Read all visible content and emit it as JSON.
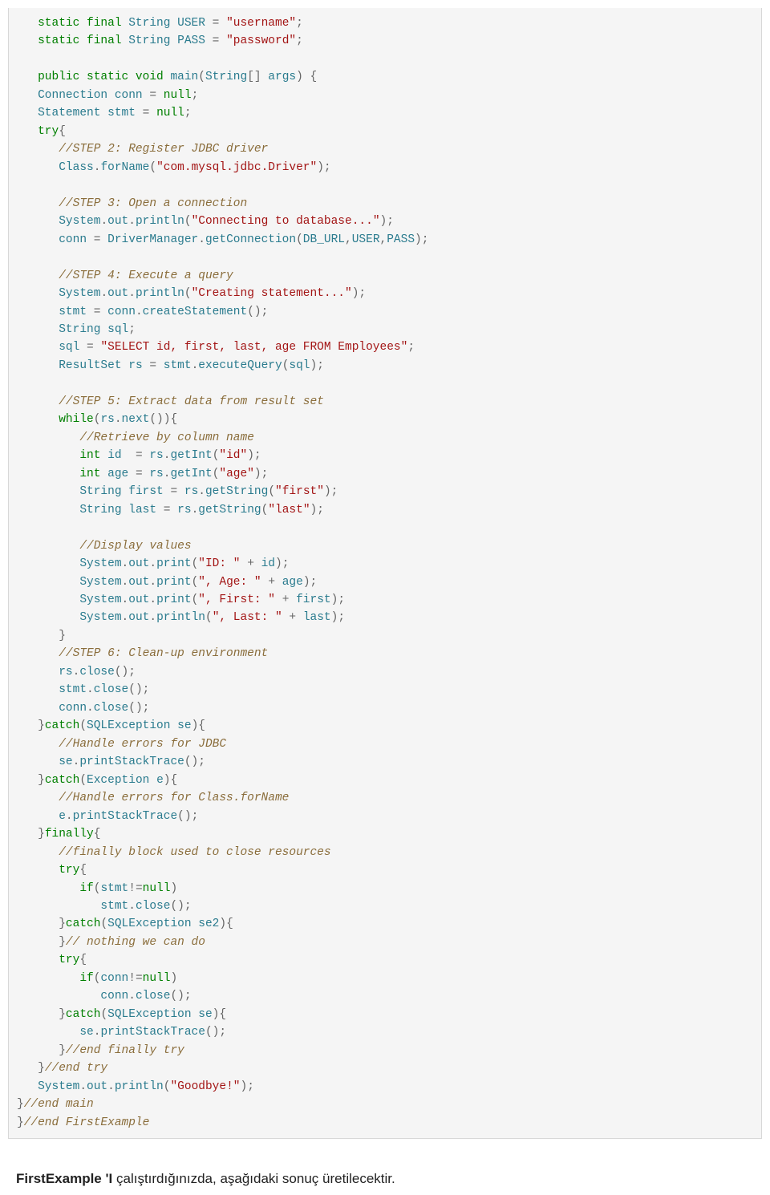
{
  "prose": {
    "sentence_a": "FirstExample 'I",
    "sentence_b": " çalıştırdığınızda, aşağıdaki sonuç üretilecektir."
  },
  "code": {
    "l01": {
      "indent": "   ",
      "k1": "static final",
      "t1": "String",
      "v1": "USER",
      "op1": "=",
      "s1": "\"username\"",
      "op2": ";"
    },
    "l02": {
      "indent": "   ",
      "k1": "static final",
      "t1": "String",
      "v1": "PASS",
      "op1": "=",
      "s1": "\"password\"",
      "op2": ";"
    },
    "l03": {
      "blank": true
    },
    "l04": {
      "indent": "   ",
      "k1": "public static void",
      "m1": "main",
      "op1": "(",
      "t1": "String",
      "op2": "[]",
      "v1": "args",
      "op3": ")",
      "op4": "{"
    },
    "l05": {
      "indent": "   ",
      "t1": "Connection",
      "v1": "conn",
      "op1": "=",
      "k1": "null",
      "op2": ";"
    },
    "l06": {
      "indent": "   ",
      "t1": "Statement",
      "v1": "stmt",
      "op1": "=",
      "k1": "null",
      "op2": ";"
    },
    "l07": {
      "indent": "   ",
      "k1": "try",
      "op1": "{"
    },
    "l08": {
      "indent": "      ",
      "c1": "//STEP 2: Register JDBC driver"
    },
    "l09": {
      "indent": "      ",
      "t1": "Class",
      "op1": ".",
      "m1": "forName",
      "op2": "(",
      "s1": "\"com.mysql.jdbc.Driver\"",
      "op3": ")",
      "op4": ";"
    },
    "l10": {
      "blank": true
    },
    "l11": {
      "indent": "      ",
      "c1": "//STEP 3: Open a connection"
    },
    "l12": {
      "indent": "      ",
      "t1": "System",
      "op1": ".",
      "v1": "out",
      "op2": ".",
      "m1": "println",
      "op3": "(",
      "s1": "\"Connecting to database...\"",
      "op4": ")",
      "op5": ";"
    },
    "l13": {
      "indent": "      ",
      "v1": "conn",
      "op1": "=",
      "t1": "DriverManager",
      "op2": ".",
      "m1": "getConnection",
      "op3": "(",
      "v2": "DB_URL",
      "op4": ",",
      "v3": "USER",
      "op5": ",",
      "v4": "PASS",
      "op6": ")",
      "op7": ";"
    },
    "l14": {
      "blank": true
    },
    "l15": {
      "indent": "      ",
      "c1": "//STEP 4: Execute a query"
    },
    "l16": {
      "indent": "      ",
      "t1": "System",
      "op1": ".",
      "v1": "out",
      "op2": ".",
      "m1": "println",
      "op3": "(",
      "s1": "\"Creating statement...\"",
      "op4": ")",
      "op5": ";"
    },
    "l17": {
      "indent": "      ",
      "v1": "stmt",
      "op1": "=",
      "v2": "conn",
      "op2": ".",
      "m1": "createStatement",
      "op3": "()",
      "op4": ";"
    },
    "l18": {
      "indent": "      ",
      "t1": "String",
      "v1": "sql",
      "op1": ";"
    },
    "l19": {
      "indent": "      ",
      "v1": "sql",
      "op1": "=",
      "s1": "\"SELECT id, first, last, age FROM Employees\"",
      "op2": ";"
    },
    "l20": {
      "indent": "      ",
      "t1": "ResultSet",
      "v1": "rs",
      "op1": "=",
      "v2": "stmt",
      "op2": ".",
      "m1": "executeQuery",
      "op3": "(",
      "v3": "sql",
      "op4": ")",
      "op5": ";"
    },
    "l21": {
      "blank": true
    },
    "l22": {
      "indent": "      ",
      "c1": "//STEP 5: Extract data from result set"
    },
    "l23": {
      "indent": "      ",
      "k1": "while",
      "op1": "(",
      "v1": "rs",
      "op2": ".",
      "m1": "next",
      "op3": "())",
      "op4": "{"
    },
    "l24": {
      "indent": "         ",
      "c1": "//Retrieve by column name"
    },
    "l25": {
      "indent": "         ",
      "k1": "int",
      "v1": "id",
      "sp": "  ",
      "op1": "=",
      "v2": "rs",
      "op2": ".",
      "m1": "getInt",
      "op3": "(",
      "s1": "\"id\"",
      "op4": ")",
      "op5": ";"
    },
    "l26": {
      "indent": "         ",
      "k1": "int",
      "v1": "age",
      "op1": "=",
      "v2": "rs",
      "op2": ".",
      "m1": "getInt",
      "op3": "(",
      "s1": "\"age\"",
      "op4": ")",
      "op5": ";"
    },
    "l27": {
      "indent": "         ",
      "t1": "String",
      "v1": "first",
      "op1": "=",
      "v2": "rs",
      "op2": ".",
      "m1": "getString",
      "op3": "(",
      "s1": "\"first\"",
      "op4": ")",
      "op5": ";"
    },
    "l28": {
      "indent": "         ",
      "t1": "String",
      "v1": "last",
      "op1": "=",
      "v2": "rs",
      "op2": ".",
      "m1": "getString",
      "op3": "(",
      "s1": "\"last\"",
      "op4": ")",
      "op5": ";"
    },
    "l29": {
      "blank": true
    },
    "l30": {
      "indent": "         ",
      "c1": "//Display values"
    },
    "l31": {
      "indent": "         ",
      "t1": "System",
      "op1": ".",
      "v1": "out",
      "op2": ".",
      "m1": "print",
      "op3": "(",
      "s1": "\"ID: \"",
      "op4": "+",
      "v2": "id",
      "op5": ")",
      "op6": ";"
    },
    "l32": {
      "indent": "         ",
      "t1": "System",
      "op1": ".",
      "v1": "out",
      "op2": ".",
      "m1": "print",
      "op3": "(",
      "s1": "\", Age: \"",
      "op4": "+",
      "v2": "age",
      "op5": ")",
      "op6": ";"
    },
    "l33": {
      "indent": "         ",
      "t1": "System",
      "op1": ".",
      "v1": "out",
      "op2": ".",
      "m1": "print",
      "op3": "(",
      "s1": "\", First: \"",
      "op4": "+",
      "v2": "first",
      "op5": ")",
      "op6": ";"
    },
    "l34": {
      "indent": "         ",
      "t1": "System",
      "op1": ".",
      "v1": "out",
      "op2": ".",
      "m1": "println",
      "op3": "(",
      "s1": "\", Last: \"",
      "op4": "+",
      "v2": "last",
      "op5": ")",
      "op6": ";"
    },
    "l35": {
      "indent": "      ",
      "op1": "}"
    },
    "l36": {
      "indent": "      ",
      "c1": "//STEP 6: Clean-up environment"
    },
    "l37": {
      "indent": "      ",
      "v1": "rs",
      "op1": ".",
      "m1": "close",
      "op2": "()",
      "op3": ";"
    },
    "l38": {
      "indent": "      ",
      "v1": "stmt",
      "op1": ".",
      "m1": "close",
      "op2": "()",
      "op3": ";"
    },
    "l39": {
      "indent": "      ",
      "v1": "conn",
      "op1": ".",
      "m1": "close",
      "op2": "()",
      "op3": ";"
    },
    "l40": {
      "indent": "   ",
      "op1": "}",
      "k1": "catch",
      "op2": "(",
      "t1": "SQLException",
      "v1": "se",
      "op3": ")",
      "op4": "{"
    },
    "l41": {
      "indent": "      ",
      "c1": "//Handle errors for JDBC"
    },
    "l42": {
      "indent": "      ",
      "v1": "se",
      "op1": ".",
      "m1": "printStackTrace",
      "op2": "()",
      "op3": ";"
    },
    "l43": {
      "indent": "   ",
      "op1": "}",
      "k1": "catch",
      "op2": "(",
      "t1": "Exception",
      "v1": "e",
      "op3": ")",
      "op4": "{"
    },
    "l44": {
      "indent": "      ",
      "c1": "//Handle errors for Class.forName"
    },
    "l45": {
      "indent": "      ",
      "v1": "e",
      "op1": ".",
      "m1": "printStackTrace",
      "op2": "()",
      "op3": ";"
    },
    "l46": {
      "indent": "   ",
      "op1": "}",
      "k1": "finally",
      "op2": "{"
    },
    "l47": {
      "indent": "      ",
      "c1": "//finally block used to close resources"
    },
    "l48": {
      "indent": "      ",
      "k1": "try",
      "op1": "{"
    },
    "l49": {
      "indent": "         ",
      "k1": "if",
      "op1": "(",
      "v1": "stmt",
      "op2": "!=",
      "k2": "null",
      "op3": ")"
    },
    "l50": {
      "indent": "            ",
      "v1": "stmt",
      "op1": ".",
      "m1": "close",
      "op2": "()",
      "op3": ";"
    },
    "l51": {
      "indent": "      ",
      "op1": "}",
      "k1": "catch",
      "op2": "(",
      "t1": "SQLException",
      "v1": "se2",
      "op3": ")",
      "op4": "{"
    },
    "l52": {
      "indent": "      ",
      "op1": "}",
      "c1": "// nothing we can do"
    },
    "l53": {
      "indent": "      ",
      "k1": "try",
      "op1": "{"
    },
    "l54": {
      "indent": "         ",
      "k1": "if",
      "op1": "(",
      "v1": "conn",
      "op2": "!=",
      "k2": "null",
      "op3": ")"
    },
    "l55": {
      "indent": "            ",
      "v1": "conn",
      "op1": ".",
      "m1": "close",
      "op2": "()",
      "op3": ";"
    },
    "l56": {
      "indent": "      ",
      "op1": "}",
      "k1": "catch",
      "op2": "(",
      "t1": "SQLException",
      "v1": "se",
      "op3": ")",
      "op4": "{"
    },
    "l57": {
      "indent": "         ",
      "v1": "se",
      "op1": ".",
      "m1": "printStackTrace",
      "op2": "()",
      "op3": ";"
    },
    "l58": {
      "indent": "      ",
      "op1": "}",
      "c1": "//end finally try"
    },
    "l59": {
      "indent": "   ",
      "op1": "}",
      "c1": "//end try"
    },
    "l60": {
      "indent": "   ",
      "t1": "System",
      "op1": ".",
      "v1": "out",
      "op2": ".",
      "m1": "println",
      "op3": "(",
      "s1": "\"Goodbye!\"",
      "op4": ")",
      "op5": ";"
    },
    "l61": {
      "op1": "}",
      "c1": "//end main"
    },
    "l62": {
      "op1": "}",
      "c1": "//end FirstExample"
    }
  }
}
